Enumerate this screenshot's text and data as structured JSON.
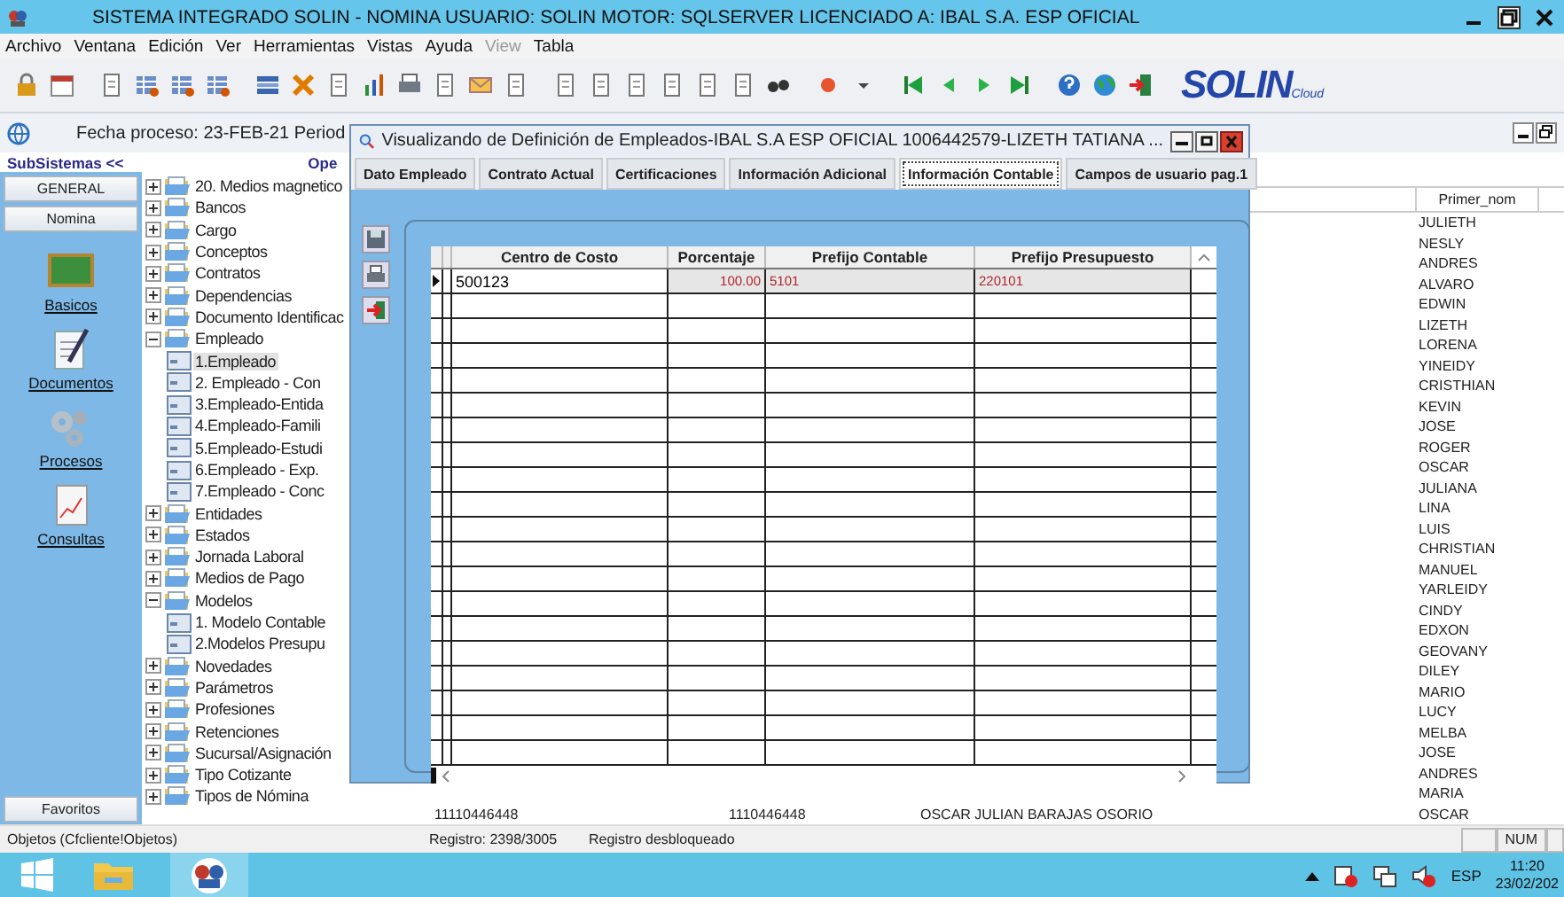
{
  "window": {
    "title": "SISTEMA INTEGRADO SOLIN - NOMINA USUARIO: SOLIN MOTOR: SQLSERVER LICENCIADO A: IBAL S.A. ESP OFICIAL"
  },
  "menu": [
    {
      "label": "Archivo",
      "disabled": false
    },
    {
      "label": "Ventana",
      "disabled": false
    },
    {
      "label": "Edición",
      "disabled": false
    },
    {
      "label": "Ver",
      "disabled": false
    },
    {
      "label": "Herramientas",
      "disabled": false
    },
    {
      "label": "Vistas",
      "disabled": false
    },
    {
      "label": "Ayuda",
      "disabled": false
    },
    {
      "label": "View",
      "disabled": true
    },
    {
      "label": "Tabla",
      "disabled": false
    }
  ],
  "logo": {
    "text": "SOLIN",
    "sub": "Cloud"
  },
  "child_window": {
    "title": "Fecha proceso: 23-FEB-21 Period",
    "subsystems_label": "SubSistemas <<",
    "column_label": "Ope"
  },
  "sidebar": {
    "groups": [
      "GENERAL",
      "Nomina"
    ],
    "modules": [
      {
        "label": "Basicos",
        "kind": "board"
      },
      {
        "label": "Documentos",
        "kind": "notes"
      },
      {
        "label": "Procesos",
        "kind": "gears"
      },
      {
        "label": "Consultas",
        "kind": "chart"
      }
    ],
    "favorites": "Favoritos"
  },
  "tree": [
    {
      "label": "20. Medios magnetico",
      "kind": "folder",
      "expanded": false
    },
    {
      "label": "Bancos",
      "kind": "folder",
      "expanded": false
    },
    {
      "label": "Cargo",
      "kind": "folder",
      "expanded": false
    },
    {
      "label": "Conceptos",
      "kind": "folder",
      "expanded": false
    },
    {
      "label": "Contratos",
      "kind": "folder",
      "expanded": false
    },
    {
      "label": "Dependencias",
      "kind": "folder",
      "expanded": false
    },
    {
      "label": "Documento Identificac",
      "kind": "folder",
      "expanded": false
    },
    {
      "label": "Empleado",
      "kind": "folder",
      "expanded": true,
      "children": [
        {
          "label": "1.Empleado",
          "kind": "form",
          "selected": true
        },
        {
          "label": "2. Empleado - Con",
          "kind": "form",
          "selected": false
        },
        {
          "label": "3.Empleado-Entida",
          "kind": "form",
          "selected": false
        },
        {
          "label": "4.Empleado-Famili",
          "kind": "form",
          "selected": false
        },
        {
          "label": "5.Empleado-Estudi",
          "kind": "form",
          "selected": false
        },
        {
          "label": "6.Empleado - Exp.",
          "kind": "form",
          "selected": false
        },
        {
          "label": "7.Empleado - Conc",
          "kind": "form",
          "selected": false
        }
      ]
    },
    {
      "label": "Entidades",
      "kind": "folder",
      "expanded": false
    },
    {
      "label": "Estados",
      "kind": "folder",
      "expanded": false
    },
    {
      "label": "Jornada Laboral",
      "kind": "folder",
      "expanded": false
    },
    {
      "label": "Medios de Pago",
      "kind": "folder",
      "expanded": false
    },
    {
      "label": "Modelos",
      "kind": "folder",
      "expanded": true,
      "children": [
        {
          "label": "1. Modelo Contable",
          "kind": "form",
          "selected": false
        },
        {
          "label": "2.Modelos Presupu",
          "kind": "form",
          "selected": false
        }
      ]
    },
    {
      "label": "Novedades",
      "kind": "folder",
      "expanded": false
    },
    {
      "label": "Parámetros",
      "kind": "folder",
      "expanded": false
    },
    {
      "label": "Profesiones",
      "kind": "folder",
      "expanded": false
    },
    {
      "label": "Retenciones",
      "kind": "folder",
      "expanded": false
    },
    {
      "label": "Sucursal/Asignación",
      "kind": "folder",
      "expanded": false
    },
    {
      "label": "Tipo Cotizante",
      "kind": "folder",
      "expanded": false
    },
    {
      "label": "Tipos de Nómina",
      "kind": "folder",
      "expanded": false
    }
  ],
  "employee_grid": {
    "columns": [
      "Primer_nom"
    ],
    "rows": [
      {
        "primer_nom": "JULIETH"
      },
      {
        "primer_nom": "NESLY"
      },
      {
        "primer_nom": "ANDRES"
      },
      {
        "primer_nom": "ALVARO"
      },
      {
        "primer_nom": "EDWIN"
      },
      {
        "primer_nom": "LIZETH"
      },
      {
        "primer_nom": "LORENA"
      },
      {
        "primer_nom": "YINEIDY"
      },
      {
        "primer_nom": "CRISTHIAN"
      },
      {
        "primer_nom": "KEVIN"
      },
      {
        "primer_nom": "JOSE"
      },
      {
        "primer_nom": "ROGER"
      },
      {
        "primer_nom": "OSCAR"
      },
      {
        "primer_nom": "JULIANA"
      },
      {
        "primer_nom": "LINA"
      },
      {
        "primer_nom": "LUIS"
      },
      {
        "primer_nom": "CHRISTIAN"
      },
      {
        "primer_nom": "MANUEL"
      },
      {
        "primer_nom": "YARLEIDY"
      },
      {
        "primer_nom": "CINDY"
      },
      {
        "primer_nom": "EDXON"
      },
      {
        "primer_nom": "GEOVANY"
      },
      {
        "primer_nom": "DILEY"
      },
      {
        "primer_nom": "MARIO"
      },
      {
        "primer_nom": "LUCY"
      },
      {
        "primer_nom": "MELBA"
      },
      {
        "primer_nom": "JOSE"
      },
      {
        "primer_nom": "ANDRES"
      },
      {
        "primer_nom": "MARIA"
      },
      {
        "column_1": "11110446448",
        "column_2": "1110446448",
        "column_3": "OSCAR JULIAN BARAJAS OSORIO",
        "primer_nom": "OSCAR"
      }
    ]
  },
  "dialog": {
    "title": "Visualizando de Definición de Empleados-IBAL S.A ESP OFICIAL 1006442579-LIZETH TATIANA ...",
    "tabs": [
      {
        "label": "Dato Empleado",
        "selected": false
      },
      {
        "label": "Contrato Actual",
        "selected": false
      },
      {
        "label": "Certificaciones",
        "selected": false
      },
      {
        "label": "Información Adicional",
        "selected": false
      },
      {
        "label": "Información Contable",
        "selected": true
      },
      {
        "label": "Campos de usuario pag.1",
        "selected": false
      }
    ],
    "table": {
      "columns": [
        "Centro de Costo",
        "Porcentaje",
        "Prefijo Contable",
        "Prefijo Presupuesto"
      ],
      "rows": [
        {
          "centro_de_costo": "500123",
          "porcentaje": "100.00",
          "prefijo_contable": "5101",
          "prefijo_presupuesto": "220101",
          "current": true
        }
      ]
    }
  },
  "status_bar": {
    "object": "Objetos (Cfcliente!Objetos)",
    "record": "Registro: 2398/3005",
    "lock_state": "Registro desbloqueado",
    "num": "NUM"
  },
  "taskbar": {
    "language": "ESP",
    "time": "11:20",
    "date": "23/02/202"
  }
}
